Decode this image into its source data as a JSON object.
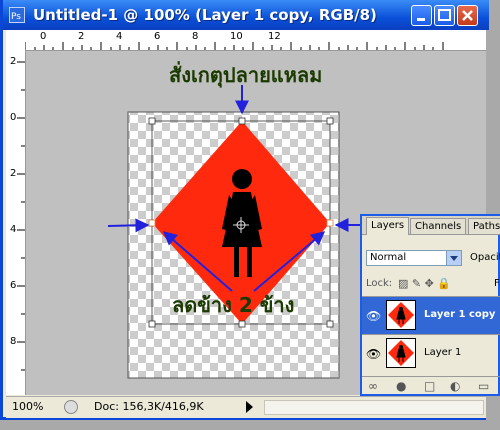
{
  "window": {
    "title": "Untitled-1 @ 100% (Layer 1 copy, RGB/8)",
    "colors": {
      "titlebar": "#0a50d8",
      "sign": "#ff2a0e",
      "arrow": "#2222dd",
      "annotation_text": "#1a3a00"
    }
  },
  "rulers": {
    "top": [
      "0",
      "2",
      "4",
      "6",
      "8",
      "10",
      "12"
    ],
    "left": [
      "2",
      "0",
      "2",
      "4",
      "6",
      "8"
    ]
  },
  "canvas": {
    "annotation_top": "สั่งเกตุปลายแหลม",
    "annotation_bottom": "ลดข้าง 2 ข้าง",
    "icons": [
      "woman-pictogram-icon",
      "move-cursor-icon"
    ]
  },
  "status": {
    "zoom": "100%",
    "doc": "Doc: 156,3K/416,9K"
  },
  "layers_panel": {
    "tabs": [
      "Layers",
      "Channels",
      "Paths"
    ],
    "blend_mode": "Normal",
    "opacity_label": "Opacit",
    "lock_label": "Lock:",
    "fill_label": "Fi",
    "layers": [
      {
        "name": "Layer 1 copy",
        "selected": true
      },
      {
        "name": "Layer 1",
        "selected": false
      }
    ],
    "bottom_icons": [
      "link-icon",
      "fx-icon",
      "mask-icon",
      "adjustment-icon",
      "folder-icon"
    ]
  }
}
